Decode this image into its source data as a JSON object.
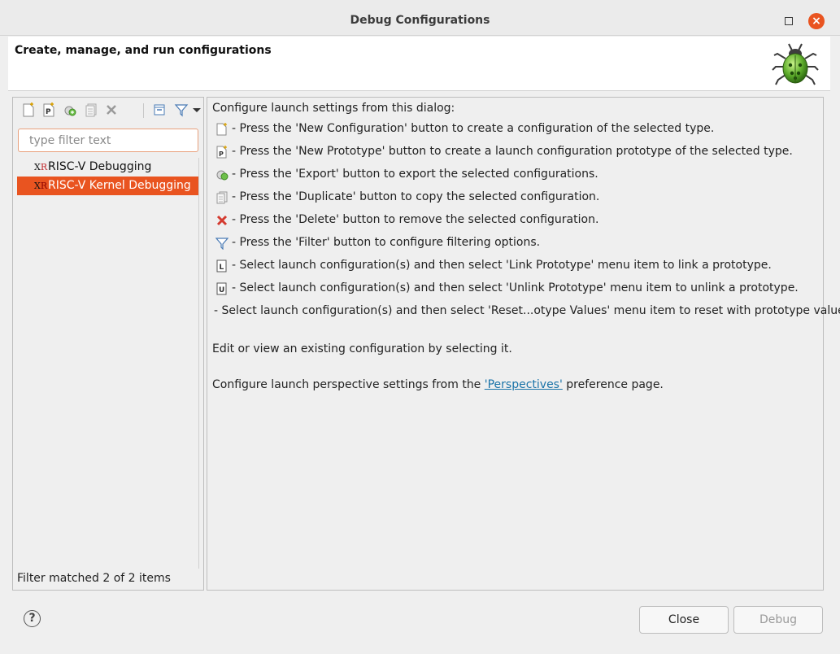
{
  "window": {
    "title": "Debug Configurations"
  },
  "banner": {
    "heading": "Create, manage, and run configurations",
    "icon": "bug-icon"
  },
  "toolbar": {
    "buttons": [
      "new-configuration-icon",
      "new-prototype-icon",
      "export-icon",
      "duplicate-icon",
      "delete-icon",
      "collapse-all-icon",
      "filter-icon",
      "view-menu-icon"
    ]
  },
  "filter": {
    "placeholder": "type filter text",
    "value": ""
  },
  "tree": {
    "items": [
      {
        "label": "RISC-V Debugging",
        "icon_text": [
          "X",
          "R"
        ],
        "selected": false
      },
      {
        "label": "RISC-V Kernel Debugging",
        "icon_text": [
          "X",
          "R"
        ],
        "selected": true
      }
    ],
    "status": "Filter matched 2 of 2 items"
  },
  "info": {
    "intro": "Configure launch settings from this dialog:",
    "rows": [
      {
        "icon": "new-configuration-icon",
        "text": "- Press the 'New Configuration' button to create a configuration of the selected type."
      },
      {
        "icon": "new-prototype-icon",
        "text": "- Press the 'New Prototype' button to create a launch configuration prototype of the selected type."
      },
      {
        "icon": "export-icon",
        "text": "- Press the 'Export' button to export the selected configurations."
      },
      {
        "icon": "duplicate-icon",
        "text": "- Press the 'Duplicate' button to copy the selected configuration."
      },
      {
        "icon": "delete-icon",
        "text": "- Press the 'Delete' button to remove the selected configuration."
      },
      {
        "icon": "filter-icon",
        "text": "- Press the 'Filter' button to configure filtering options."
      },
      {
        "icon": "link-prototype-icon",
        "text": "- Select launch configuration(s) and then select 'Link Prototype' menu item to link a prototype."
      },
      {
        "icon": "unlink-prototype-icon",
        "text": "- Select launch configuration(s) and then select 'Unlink Prototype' menu item to unlink a prototype."
      }
    ],
    "reset_text": "- Select launch configuration(s) and then select 'Reset...otype Values' menu item to reset with prototype values.",
    "edit_text": "Edit or view an existing configuration by selecting it.",
    "perspective_prefix": "Configure launch perspective settings from the ",
    "perspective_link": "'Perspectives'",
    "perspective_suffix": " preference page."
  },
  "buttons": {
    "help": "?",
    "close": "Close",
    "debug": "Debug"
  },
  "colors": {
    "accent": "#e95420",
    "link": "#1a73a8"
  }
}
